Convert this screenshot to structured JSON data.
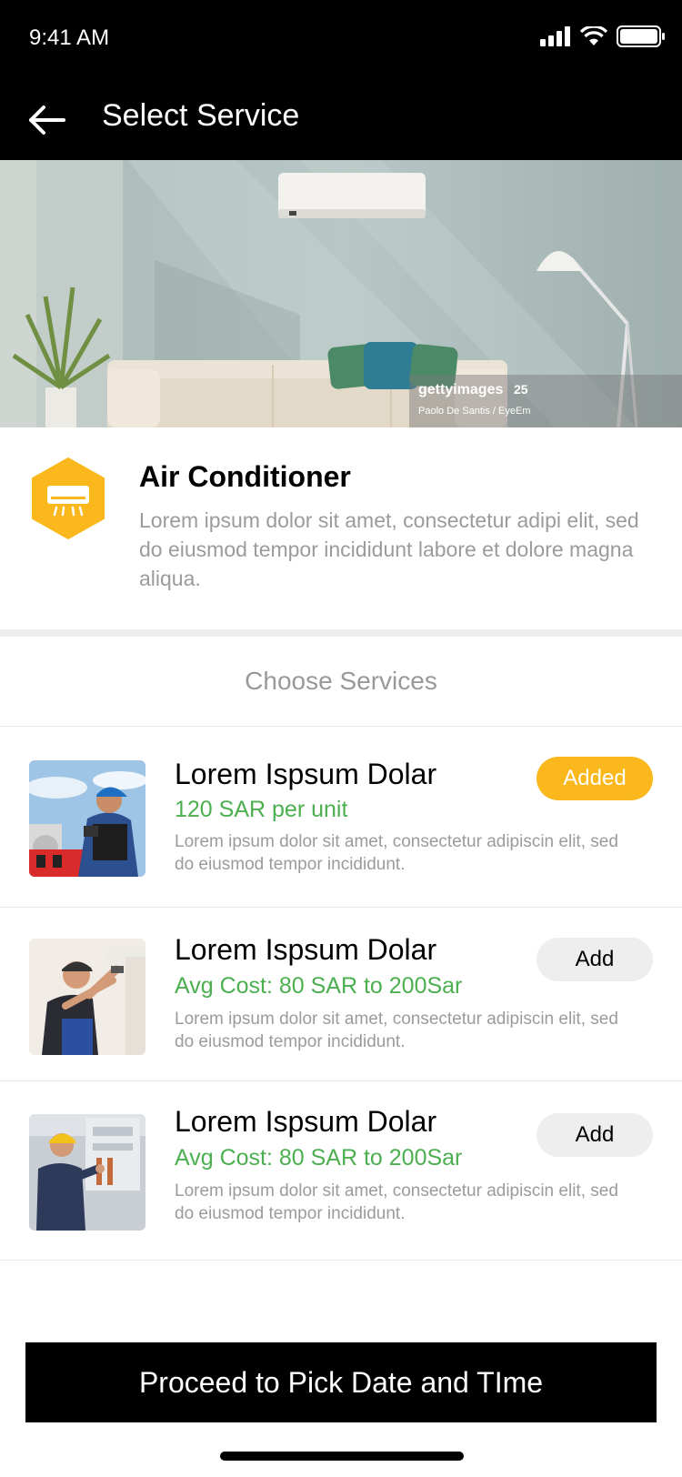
{
  "status_bar": {
    "time": "9:41 AM"
  },
  "app_bar": {
    "title": "Select Service"
  },
  "hero": {
    "watermark_brand": "gettyimages",
    "watermark_credit": "Paolo De Santis / EyeEm",
    "watermark_years": "25"
  },
  "category": {
    "title": "Air Conditioner",
    "description": "Lorem ipsum dolor sit amet, consectetur adipi elit, sed do eiusmod tempor incididunt labore et dolore magna aliqua.",
    "icon": "air-conditioner-icon",
    "icon_color": "#FBB81C"
  },
  "section": {
    "title": "Choose Services"
  },
  "services": [
    {
      "title": "Lorem Ispsum Dolar",
      "price": "120 SAR per unit",
      "description": "Lorem ipsum dolor sit amet, consectetur adipiscin elit, sed do eiusmod tempor incididunt.",
      "button": "Added",
      "added": true
    },
    {
      "title": "Lorem Ispsum Dolar",
      "price": "Avg Cost: 80 SAR to 200Sar",
      "description": "Lorem ipsum dolor sit amet, consectetur adipiscin elit, sed do eiusmod tempor incididunt.",
      "button": "Add",
      "added": false
    },
    {
      "title": "Lorem Ispsum Dolar",
      "price": "Avg Cost: 80 SAR to 200Sar",
      "description": "Lorem ipsum dolor sit amet, consectetur adipiscin elit, sed do eiusmod tempor incididunt.",
      "button": "Add",
      "added": false
    }
  ],
  "proceed_button": {
    "label": "Proceed to Pick Date and TIme"
  },
  "colors": {
    "accent": "#FBB81C",
    "price_green": "#4CAF50",
    "bar_black": "#000000"
  }
}
